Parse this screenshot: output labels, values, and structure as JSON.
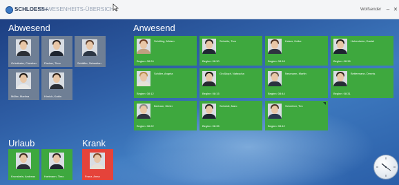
{
  "window": {
    "app_name": "SCHLOESS+",
    "view_title": "ANWESENHEITS-ÜBERSICHT",
    "user_name": "Wolfsender",
    "minimize_glyph": "–",
    "close_glyph": "✕"
  },
  "sections": {
    "absent": "Abwesend",
    "present": "Anwesend",
    "vacation": "Urlaub",
    "sick": "Krank"
  },
  "absent_people": [
    {
      "name": "Grünthaler, Christian",
      "hair": "#3a2a1e",
      "shirt": "#2b2f36"
    },
    {
      "name": "Fischer, Timo",
      "hair": "#2a2320",
      "shirt": "#1e2530"
    },
    {
      "name": "Schäffer, Sebastian",
      "hair": "#5a4030",
      "shirt": "#2c3644"
    },
    {
      "name": "Müller, Martina",
      "hair": "#1c1714",
      "shirt": "#e8e8e8"
    },
    {
      "name": "Hinrich, Katrin",
      "hair": "#2a1f18",
      "shirt": "#2a2e36"
    }
  ],
  "present_people": [
    {
      "name": "Schöling, Miriam",
      "since": "Beginn: 08:24",
      "hair": "#6b3b22",
      "shirt": "#c0a080"
    },
    {
      "name": "Schmitz, Tom",
      "since": "Beginn: 08:30",
      "hair": "#2c2420",
      "shirt": "#202833"
    },
    {
      "name": "Kaiser, Heike",
      "since": "Beginn: 08:18",
      "hair": "#4a3020",
      "shirt": "#2e3440"
    },
    {
      "name": "Hohenheim, Daniel",
      "since": "Beginn: 08:36",
      "hair": "#1e1a16",
      "shirt": "#1e2430"
    },
    {
      "name": "Schiller, Angela",
      "since": "Beginn: 08:12",
      "hair": "#b89050",
      "shirt": "#e6e2d8"
    },
    {
      "name": "Großkopf, Natascha",
      "since": "Beginn: 08:15",
      "hair": "#1a1512",
      "shirt": "#262a30"
    },
    {
      "name": "Neumann, Martin",
      "since": "Beginn: 08:44",
      "hair": "#6a5a4a",
      "shirt": "#2a3240"
    },
    {
      "name": "Bettermann, Dennis",
      "since": "Beginn: 08:31",
      "hair": "#3a2a20",
      "shirt": "#262c36"
    },
    {
      "name": "Bertram, Dieter",
      "since": "Beginn: 08:22",
      "hair": "#8a8a88",
      "shirt": "#2e3440"
    },
    {
      "name": "Schmidt, Marc",
      "since": "Beginn: 08:35",
      "hair": "#2a2220",
      "shirt": "#1e2530"
    },
    {
      "name": "Schreiber, Tim",
      "since": "Beginn: 08:42",
      "hair": "#4a3525",
      "shirt": "#2a3a4e"
    }
  ],
  "vacation_people": [
    {
      "name": "Kronsbein, Andreas",
      "hair": "#3a2a1e",
      "shirt": "#2a2f38"
    },
    {
      "name": "Hartmann, Timo",
      "hair": "#2a2220",
      "shirt": "#1e2530"
    }
  ],
  "sick_people": [
    {
      "name": "Franz, Anna",
      "hair": "#7a4a28",
      "shirt": "#e8e0d6"
    }
  ],
  "colors": {
    "absent_tile": "#6f7f95",
    "present_tile": "#3ea83e",
    "sick_tile": "#e5433a"
  }
}
